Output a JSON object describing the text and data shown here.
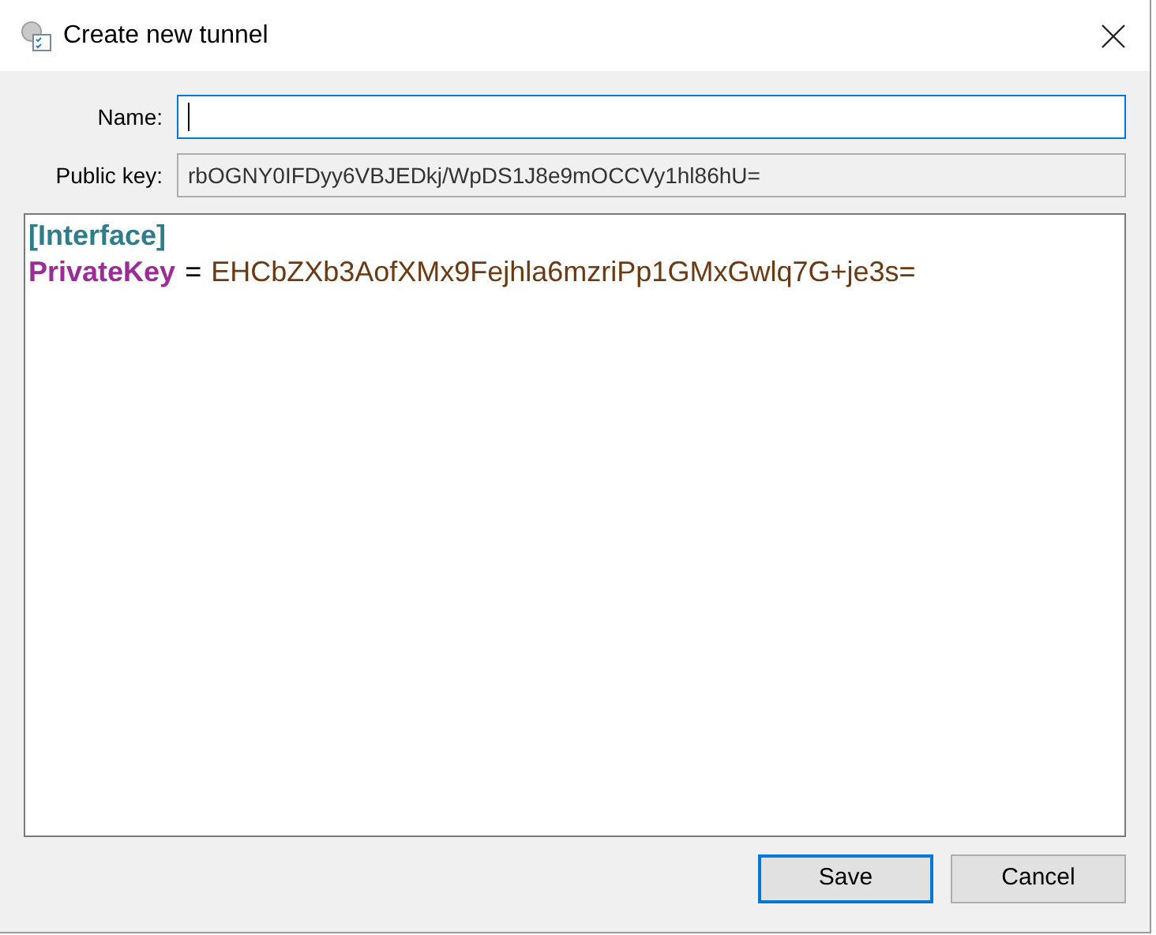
{
  "window": {
    "title": "Create new tunnel"
  },
  "name_field": {
    "label": "Name:",
    "focused": true
  },
  "public_key": {
    "label": "Public key:",
    "value": "rbOGNY0IFDyy6VBJEDkj/WpDS1J8e9mOCCVy1hl86hU="
  },
  "editor": {
    "lines": [
      {
        "kind": "section",
        "text": "[Interface]"
      },
      {
        "kind": "pair",
        "key": "PrivateKey",
        "separator": "=",
        "value": "EHCbZXb3AofXMx9Fejhla6mzriPp1GMxGwlq7G+je3s="
      }
    ]
  },
  "buttons": [
    {
      "label": "Save",
      "default": true
    },
    {
      "label": "Cancel",
      "default": false
    }
  ]
}
